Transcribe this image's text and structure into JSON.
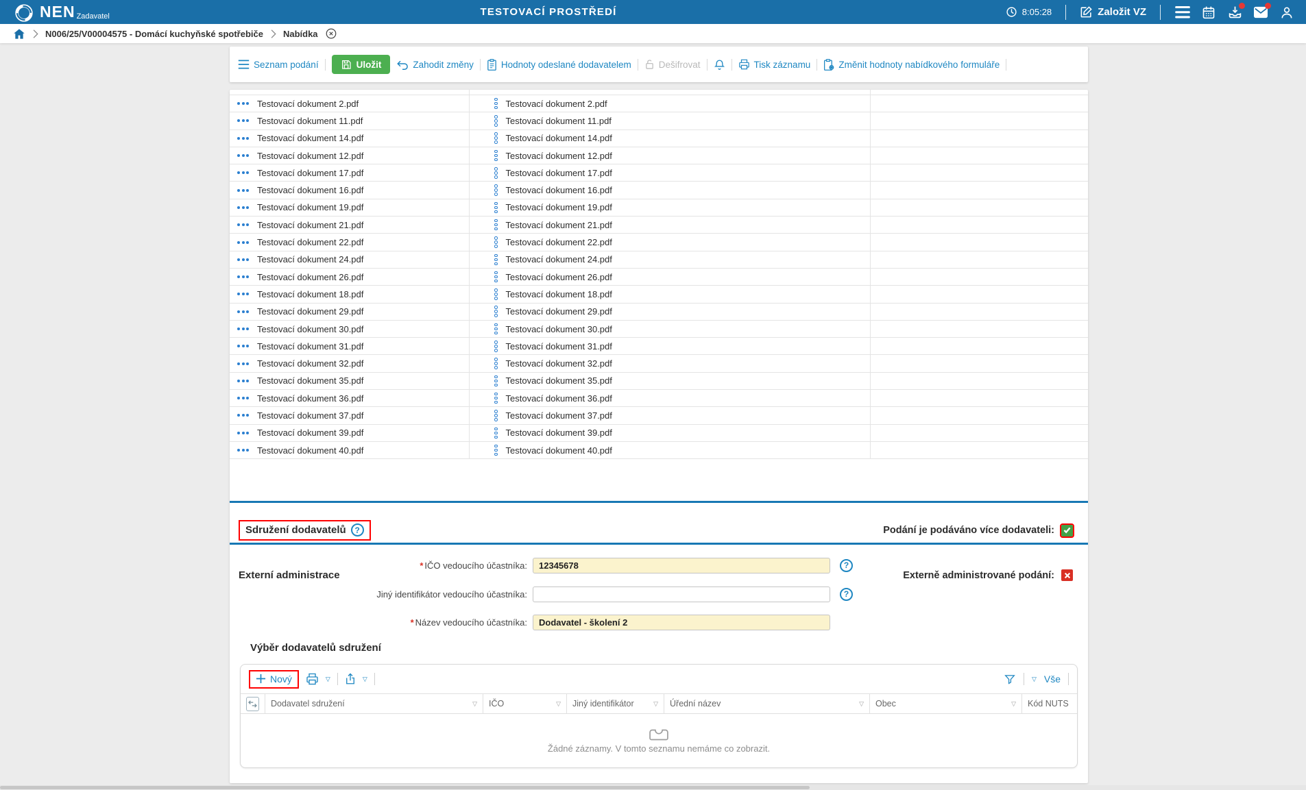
{
  "topbar": {
    "logo": "NEN",
    "logo_sub": "Zadavatel",
    "title": "TESTOVACÍ PROSTŘEDÍ",
    "time": "8:05:28",
    "create_button": "Založit VZ",
    "accent_color": "#1a6fa8"
  },
  "breadcrumb": {
    "item1": "N006/25/V00004575 - Domácí kuchyňské spotřebiče",
    "item2": "Nabídka"
  },
  "toolbar": {
    "seznam": "Seznam podání",
    "ulozit": "Uložit",
    "zahodit": "Zahodit změny",
    "hodnoty": "Hodnoty odeslané dodavatelem",
    "desifrovat": "Dešifrovat",
    "tisk": "Tisk záznamu",
    "zmenit": "Změnit hodnoty nabídkového formuláře",
    "save_color": "#4caf50",
    "link_color": "#1e87c2"
  },
  "documents": {
    "rows": [
      "Testovací dokument 2.pdf",
      "Testovací dokument 11.pdf",
      "Testovací dokument 14.pdf",
      "Testovací dokument 12.pdf",
      "Testovací dokument 17.pdf",
      "Testovací dokument 16.pdf",
      "Testovací dokument 19.pdf",
      "Testovací dokument 21.pdf",
      "Testovací dokument 22.pdf",
      "Testovací dokument 24.pdf",
      "Testovací dokument 26.pdf",
      "Testovací dokument 18.pdf",
      "Testovací dokument 29.pdf",
      "Testovací dokument 30.pdf",
      "Testovací dokument 31.pdf",
      "Testovací dokument 32.pdf",
      "Testovací dokument 35.pdf",
      "Testovací dokument 36.pdf",
      "Testovací dokument 37.pdf",
      "Testovací dokument 39.pdf",
      "Testovací dokument 40.pdf"
    ]
  },
  "sections": {
    "external_admin": {
      "title": "Externí administrace",
      "right_label": "Externě administrované podání:",
      "value": false,
      "flag_color": "#d93025"
    },
    "association": {
      "title": "Sdružení dodavatelů",
      "right_label": "Podání je podáváno více dodavateli:",
      "value": true,
      "flag_color": "#43a047"
    }
  },
  "form": {
    "rows": [
      {
        "label": "IČO vedoucího účastníka:",
        "required": true,
        "value": "12345678",
        "highlighted": true
      },
      {
        "label": "Jiný identifikátor vedoucího účastníka:",
        "required": false,
        "value": "",
        "highlighted": false
      },
      {
        "label": "Název vedoucího účastníka:",
        "required": true,
        "value": "Dodavatel - školení 2",
        "highlighted": true
      }
    ]
  },
  "supplier_picker": {
    "title": "Výběr dodavatelů sdružení",
    "new_button": "Nový",
    "all_label": "Vše",
    "columns": [
      "Dodavatel sdružení",
      "IČO",
      "Jiný identifikátor",
      "Úřední název",
      "Obec",
      "Kód NUTS"
    ],
    "empty_text": "Žádné záznamy. V tomto seznamu nemáme co zobrazit."
  }
}
